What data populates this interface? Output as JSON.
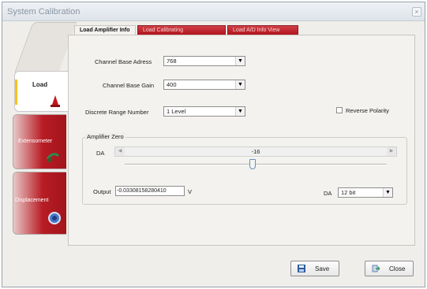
{
  "window": {
    "title": "System Calibration",
    "close_glyph": "×"
  },
  "side_tabs": [
    {
      "label": "Load",
      "icon": "load-cell-icon"
    },
    {
      "label": "Extensometer",
      "icon": "extensometer-icon"
    },
    {
      "label": "Displacement",
      "icon": "displacement-icon"
    }
  ],
  "top_tabs": [
    {
      "label": "Load Amplifier Info"
    },
    {
      "label": "Load Calibrating"
    },
    {
      "label": "Load A/D Info View"
    }
  ],
  "fields": {
    "channel_base_address": {
      "label": "Channel Base Adress",
      "value": "768"
    },
    "channel_base_gain": {
      "label": "Channel Base Gain",
      "value": "400"
    },
    "discrete_range_number": {
      "label": "Discrete Range Number",
      "value": "1 Level"
    },
    "reverse_polarity": {
      "label": "Reverse Polarity",
      "checked": false
    }
  },
  "amplifier_zero": {
    "title": "Amplifier Zero",
    "da_label": "DA",
    "da_value": "-16",
    "output_label": "Output",
    "output_value": "-0.03308158280410",
    "output_unit": "V",
    "da_bits_label": "DA",
    "da_bits_value": "12 bit"
  },
  "buttons": {
    "save": "Save",
    "close": "Close"
  },
  "colors": {
    "accent_red": "#b81c24",
    "tab_marker": "#f4c21d"
  }
}
